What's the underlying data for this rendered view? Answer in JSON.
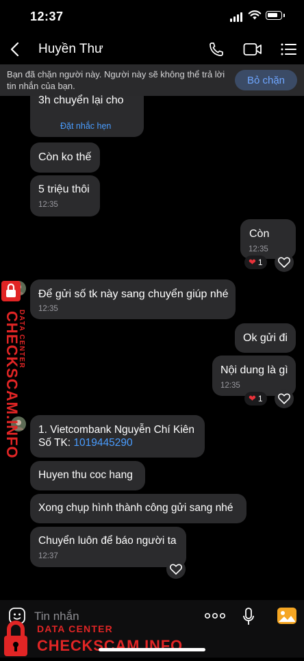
{
  "status": {
    "time": "12:37"
  },
  "header": {
    "contact_name": "Huyền Thư"
  },
  "banner": {
    "text": "Bạn đã chặn người này. Người này sẽ không thể trả lời tin nhắn của bạn.",
    "unblock_label": "Bỏ chặn"
  },
  "messages": [
    {
      "text": "3h chuyển lại cho",
      "action": "Đặt nhắc hẹn"
    },
    {
      "text": "Còn ko thế"
    },
    {
      "text": "5 triệu thôi",
      "time": "12:35"
    },
    {
      "text": "Còn",
      "time": "12:35",
      "reaction_count": "1"
    },
    {
      "text": "Để gửi số tk này sang chuyển giúp nhé",
      "time": "12:35"
    },
    {
      "text": "Ok gửi đi"
    },
    {
      "text": "Nội dung là gì",
      "time": "12:35",
      "reaction_count": "1"
    },
    {
      "line1": "1. Vietcombank Nguyễn Chí Kiên",
      "line2_prefix": "Số TK: ",
      "account_number": "1019445290"
    },
    {
      "text": "Huyen thu coc hang"
    },
    {
      "text": "Xong chụp hình thành công gửi sang nhé"
    },
    {
      "text": "Chuyển luôn để báo người ta",
      "time": "12:37"
    }
  ],
  "input": {
    "placeholder": "Tin nhắn"
  },
  "watermark": {
    "side_line1": "DATA CENTER",
    "side_line2": "CHECKSCAM.INFO",
    "bottom_line1": "DATA CENTER",
    "bottom_line2": "CHECKSCAM.INFO"
  },
  "colors": {
    "accent": "#4a9dff",
    "bubble": "#2b2b2d",
    "watermark": "#e12525"
  }
}
